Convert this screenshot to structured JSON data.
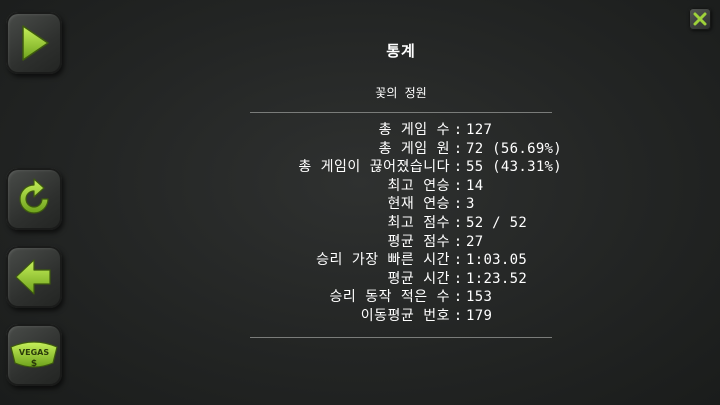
{
  "dialog": {
    "title": "통계",
    "subtitle": "꽃의 정원",
    "separator": ":"
  },
  "stats": [
    {
      "label": "총 게임 수",
      "value": "127"
    },
    {
      "label": "총 게임 원",
      "value": "72 (56.69%)"
    },
    {
      "label": "총 게임이 끊어졌습니다",
      "value": "55 (43.31%)"
    },
    {
      "label": "최고 연승",
      "value": "14"
    },
    {
      "label": "현재 연승",
      "value": "3"
    },
    {
      "label": "최고 점수",
      "value": "52 / 52"
    },
    {
      "label": "평균 점수",
      "value": "27"
    },
    {
      "label": "승리 가장 빠른 시간",
      "value": "1:03.05"
    },
    {
      "label": "평균 시간",
      "value": "1:23.52"
    },
    {
      "label": "승리 동작 적은 수",
      "value": "153"
    },
    {
      "label": "이동평균 번호",
      "value": "179"
    }
  ],
  "side_buttons": {
    "vegas_sign_text": "VEGAS",
    "vegas_dollar": "$"
  },
  "icons": {
    "play": "play-icon",
    "restart": "restart-icon",
    "back": "back-arrow-icon",
    "vegas": "vegas-sign-icon",
    "close": "close-icon"
  },
  "colors": {
    "accent_green": "#9ed13a",
    "background": "#262827",
    "text": "#ffffff",
    "rule": "#7a7c7a"
  }
}
